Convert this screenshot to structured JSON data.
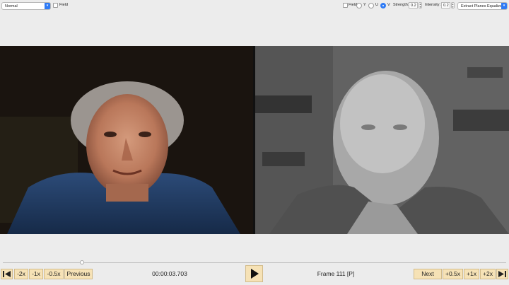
{
  "top_toolbar": {
    "mode_select": {
      "value": "Normal"
    },
    "left_field_label": "Field",
    "right_field_label": "Field",
    "planes": [
      {
        "label": "Y",
        "selected": false
      },
      {
        "label": "U",
        "selected": false
      },
      {
        "label": "V",
        "selected": true
      }
    ],
    "strength_label": "Strength:",
    "strength_value": "0.2",
    "intensity_label": "Intensity:",
    "intensity_value": "0.2",
    "filter_select": {
      "value": "Extract Planes Equalized"
    }
  },
  "playback": {
    "buttons_left": [
      "-2x",
      "-1x",
      "-0.5x",
      "Previous"
    ],
    "timecode": "00:00:03.703",
    "frame_label": "Frame 111 [P]",
    "buttons_right": [
      "Next",
      "+0.5x",
      "+1x",
      "+2x"
    ],
    "position": 0.16
  },
  "colors": {
    "button_bg": "#f6e2b6",
    "accent": "#2f7bf5"
  }
}
